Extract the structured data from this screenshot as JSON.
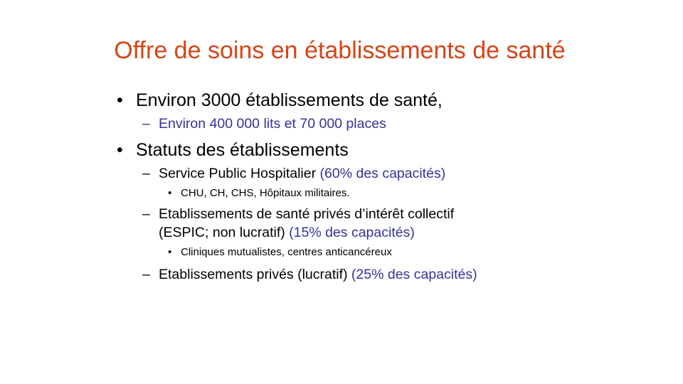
{
  "slide": {
    "title": "Offre de soins en établissements de santé",
    "bullet_l1": "•",
    "bullet_l2": "–",
    "bullet_l3": "•",
    "items": {
      "item1": "Environ 3000 établissements de santé,",
      "item1_sub": "Environ 400 000 lits et 70 000 places",
      "item2": "Statuts des établissements",
      "public_label": "Service Public Hospitalier ",
      "public_share": "(60% des capacités)",
      "public_examples": "CHU,  CH,  CHS, Hôpitaux  militaires.",
      "espic_label_line1": "Etablissements de santé privés d’intérêt collectif",
      "espic_label_line2": "(ESPIC; non lucratif) ",
      "espic_share": "(15% des capacités)",
      "espic_examples": "Cliniques  mutualistes,  centres anticancéreux",
      "private_label": "Etablissements privés (lucratif) ",
      "private_share": "(25% des capacités)"
    }
  },
  "colors": {
    "title": "#d84315",
    "accent": "#333399",
    "text": "#000000",
    "background": "#ffffff"
  }
}
